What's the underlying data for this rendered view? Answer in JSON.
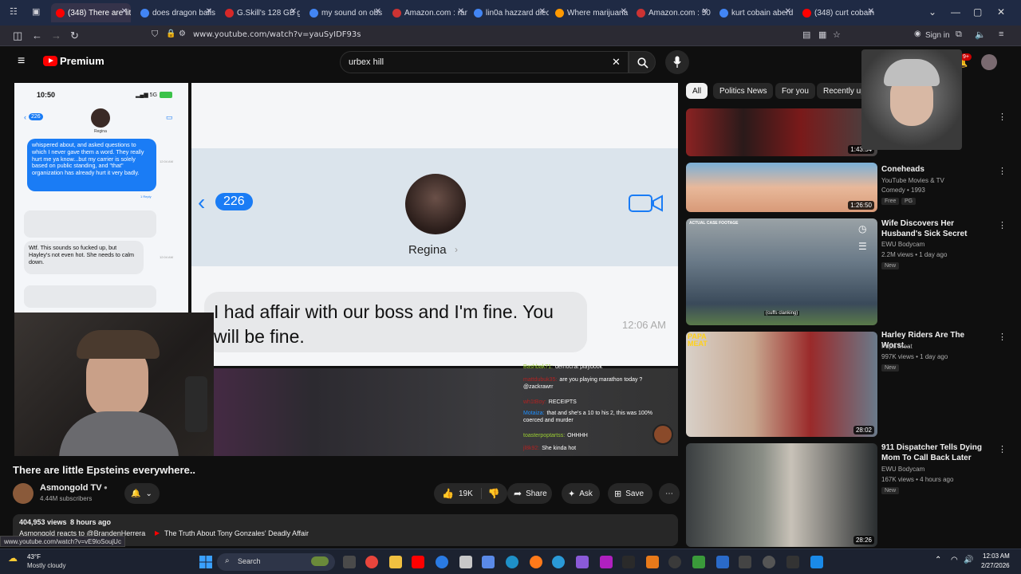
{
  "browser": {
    "tabs": [
      {
        "label": "(348) There are littl",
        "color": "#ff0000",
        "active": true
      },
      {
        "label": "does dragon balls",
        "color": "#4285f4"
      },
      {
        "label": "G.Skill's 128 GB g",
        "color": "#d62828"
      },
      {
        "label": "my sound on obs",
        "color": "#4285f4"
      },
      {
        "label": "Amazon.com : ram",
        "color": "#c33"
      },
      {
        "label": "lin0a hazzard died",
        "color": "#4285f4"
      },
      {
        "label": "Where marijuana i",
        "color": "#ff9900"
      },
      {
        "label": "Amazon.com : 50",
        "color": "#c33"
      },
      {
        "label": "kurt cobain aberd",
        "color": "#4285f4"
      },
      {
        "label": "(348) curt cobain",
        "color": "#ff0000"
      }
    ],
    "url": "www.youtube.com/watch?v=yauSyIDF93s",
    "sign_in": "Sign in",
    "status_url": "www.youtube.com/watch?v=vE9loSoujUc"
  },
  "youtube": {
    "logo_text": "Premium",
    "search_value": "urbex hill",
    "notif_count": "9+"
  },
  "video": {
    "phone_time": "10:50",
    "phone_back_count": "226",
    "phone_contact": "Regina",
    "phone_msg_1": "whispered about, and asked questions to which I never gave them a word. They really hurt me ya know...but my carrier is solely based on public standing, and \"that\" organization has already hurt it very badly.",
    "phone_msg_1_time": "12:04 AM",
    "phone_reply": "1 Reply",
    "phone_msg_2": "Wtf. This sounds so fucked up, but Hayley's not even hot. She needs to calm down.",
    "phone_msg_2_time": "12:04 AM",
    "zoom_back_count": "226",
    "zoom_contact": "Regina",
    "zoom_message": "I had affair with our boss and I'm fine. You will be fine.",
    "zoom_time": "12:06 AM",
    "chat": [
      {
        "user": "Bashbak71:",
        "user_color": "#9acd32",
        "text": "democrat playbook"
      },
      {
        "user": "mattdubuk35:",
        "user_color": "#b22222",
        "text": "are you playing marathon today ? @zackrawrr"
      },
      {
        "user": "wh1tBoy:",
        "user_color": "#b22222",
        "text": "RECEIPTS"
      },
      {
        "user": "Motaiza:",
        "user_color": "#1e90ff",
        "text": "that and she's a 10 to his 2, this was 100% coerced and murder"
      },
      {
        "user": "toasterpoptartss:",
        "user_color": "#9acd32",
        "text": "OHHHH"
      },
      {
        "user": "jl8k92:",
        "user_color": "#b22222",
        "text": "She kinda hot"
      }
    ],
    "cuffs_caption": "(cuffs clanking)"
  },
  "watch": {
    "title": "There are little Epsteins everywhere..",
    "channel": "Asmongold TV",
    "subscribers": "4.44M subscribers",
    "likes": "19K",
    "share": "Share",
    "ask": "Ask",
    "save": "Save",
    "views": "404,953 views",
    "age": "8 hours ago",
    "desc_line": "Asmongold reacts to @BrandenHerrera",
    "desc_link": "The Truth About Tony Gonzales' Deadly Affair"
  },
  "sidebar": {
    "chips": [
      "All",
      "Politics News",
      "For you",
      "Recently up"
    ],
    "videos": [
      {
        "duration": "1:43:54",
        "title": "",
        "channel": "",
        "meta": "",
        "badge": ""
      },
      {
        "duration": "1:26:50",
        "title": "Coneheads",
        "channel": "YouTube Movies & TV",
        "meta": "Comedy • 1993",
        "badge": "Free",
        "rating": "PG"
      },
      {
        "duration": "",
        "title": "Wife Discovers Her Husband's Sick Secret",
        "channel": "EWU Bodycam",
        "meta": "2.2M views • 1 day ago",
        "badge": "New",
        "thumb_tag": "ACTUAL CASE FOOTAGE"
      },
      {
        "duration": "28:02",
        "title": "Harley Riders Are The Worst...",
        "channel": "Papa Meat",
        "meta": "997K views • 1 day ago",
        "badge": "New",
        "thumb_tag": "PAPA MEAT"
      },
      {
        "duration": "28:26",
        "title": "911 Dispatcher Tells Dying Mom To Call Back Later",
        "channel": "EWU Bodycam",
        "meta": "167K views • 4 hours ago",
        "badge": "New"
      }
    ]
  },
  "taskbar": {
    "temp": "43°F",
    "weather": "Mostly cloudy",
    "search": "Search",
    "time": "12:03 AM",
    "date": "2/27/2026"
  }
}
